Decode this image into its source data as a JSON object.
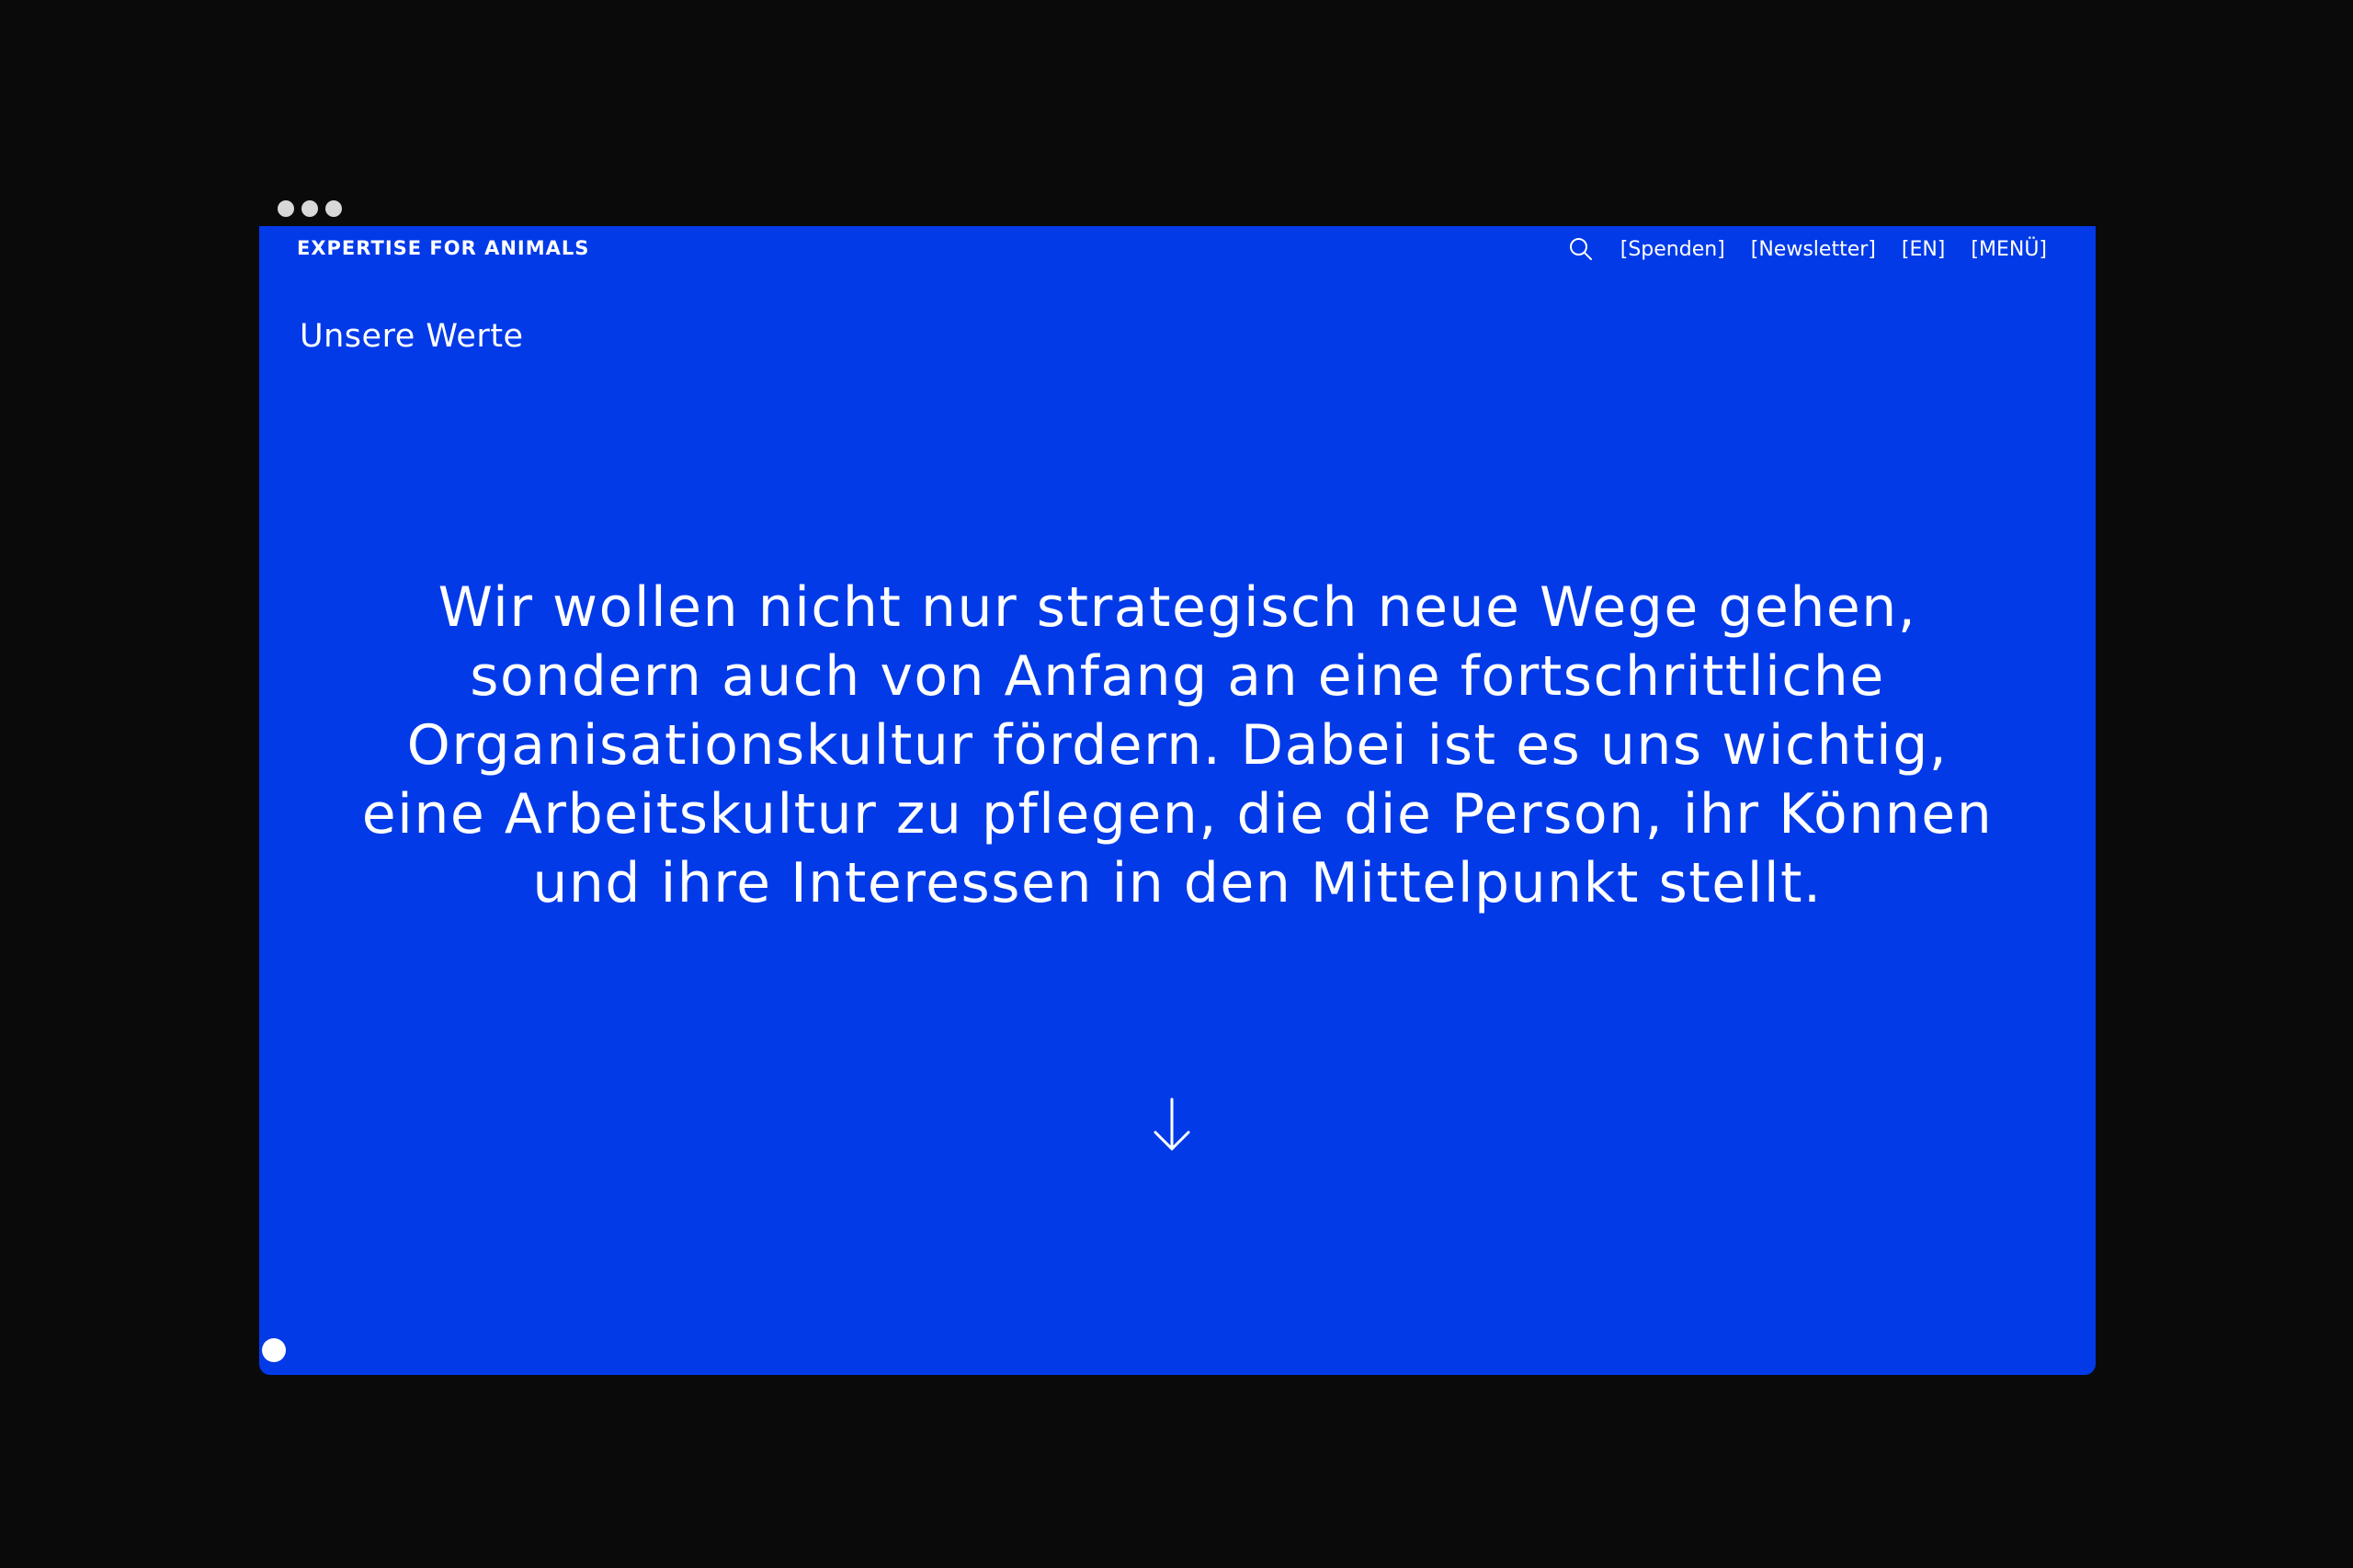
{
  "site": {
    "logo_text": "EXPERTISE FOR ANIMALS"
  },
  "nav": {
    "search_icon": "search-icon",
    "donate_label": "[Spenden]",
    "newsletter_label": "[Newsletter]",
    "language_label": "[EN]",
    "menu_label": "[MENÜ]"
  },
  "main": {
    "section_title": "Unsere Werte",
    "statement_lines": [
      "Wir wollen nicht nur strategisch neue Wege gehen,",
      "sondern auch von Anfang an eine fortschrittliche",
      "Organisationskultur fördern. Dabei ist es uns wichtig,",
      "eine Arbeitskultur zu pflegen, die die Person, ihr Können",
      "und ihre Interessen in den Mittelpunkt stellt."
    ],
    "scroll_icon": "arrow-down-icon"
  },
  "colors": {
    "brand_blue": "#023ae8",
    "text": "#ffffff",
    "background": "#0a0a0a"
  }
}
